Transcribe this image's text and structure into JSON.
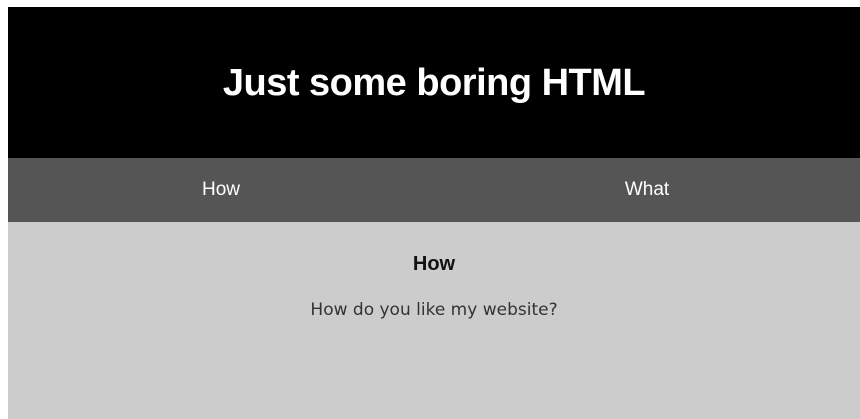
{
  "header": {
    "title": "Just some boring HTML"
  },
  "nav": {
    "items": [
      {
        "label": "How"
      },
      {
        "label": "What"
      }
    ]
  },
  "main": {
    "heading": "How",
    "text": "How do you like my website?"
  },
  "colors": {
    "header_bg": "#000000",
    "nav_bg": "#555555",
    "content_bg": "#cccccc",
    "header_text": "#ffffff"
  }
}
